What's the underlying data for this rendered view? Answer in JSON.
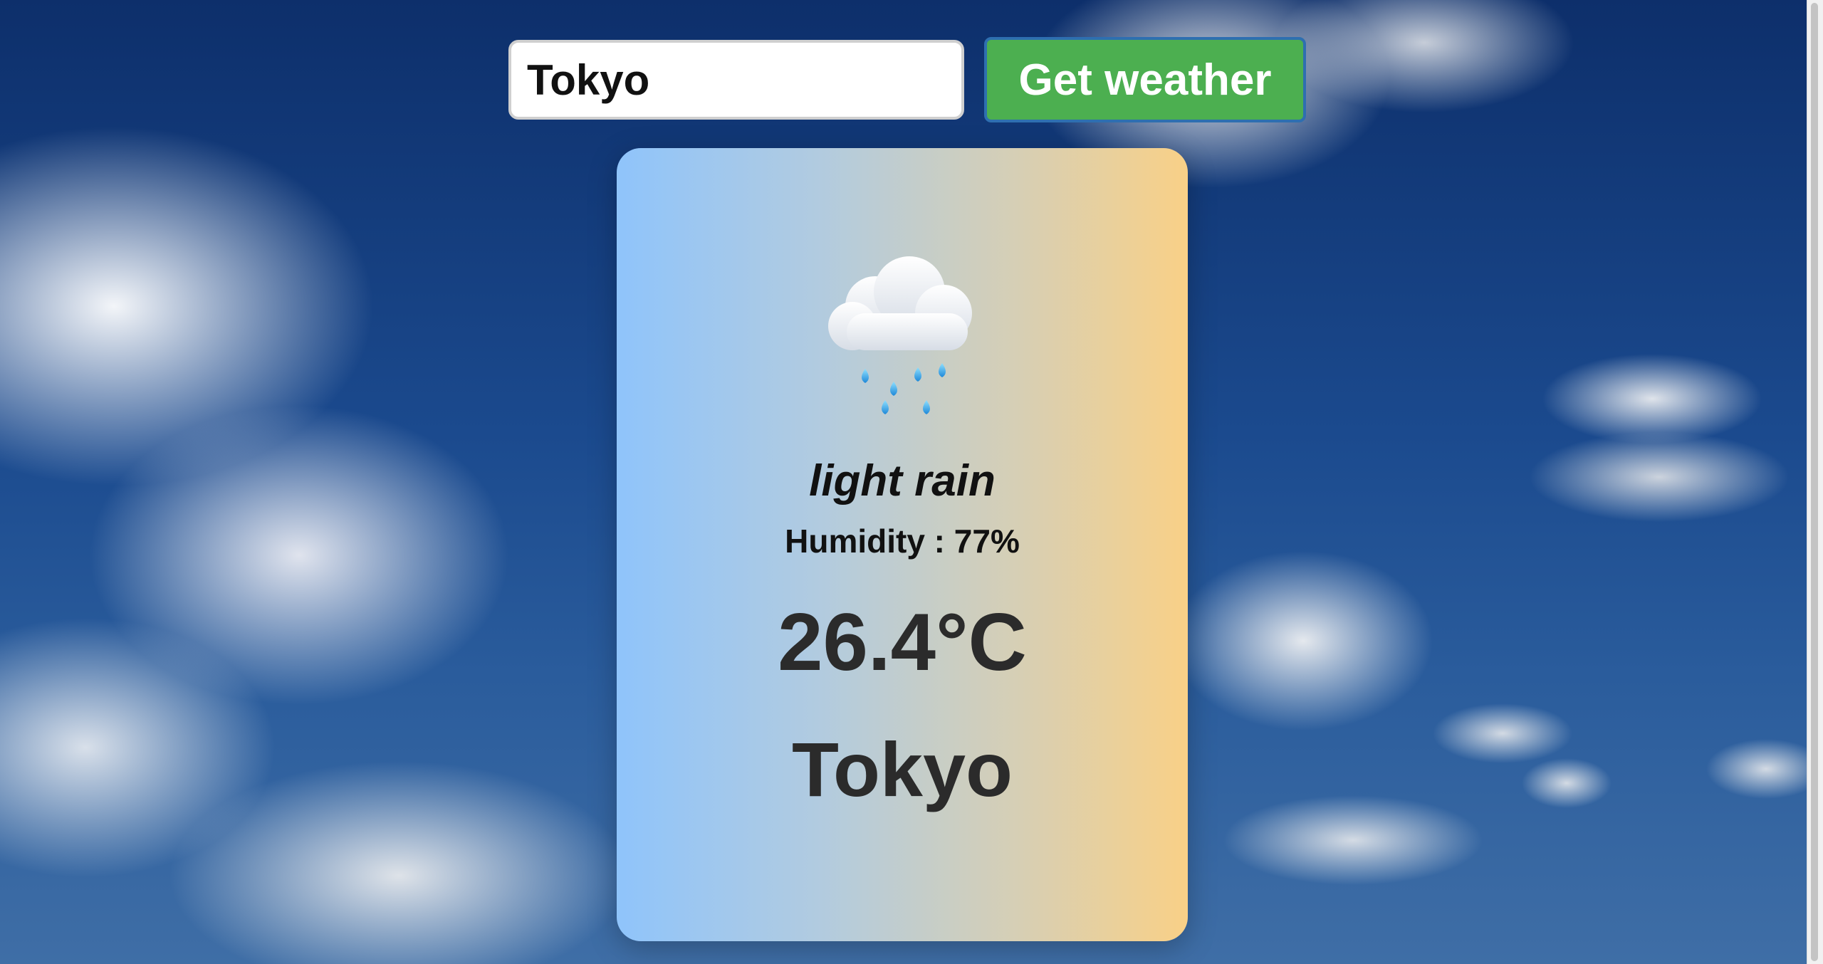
{
  "search": {
    "city_value": "Tokyo",
    "button_label": "Get weather"
  },
  "weather": {
    "icon": "rain-cloud-icon",
    "description": "light rain",
    "humidity": "Humidity : 77%",
    "temperature": "26.4°C",
    "city": "Tokyo"
  },
  "colors": {
    "button": "#4caf50",
    "button_border": "#2e6fb0",
    "card_gradient_start": "#8fc4fb",
    "card_gradient_end": "#f9d087"
  }
}
